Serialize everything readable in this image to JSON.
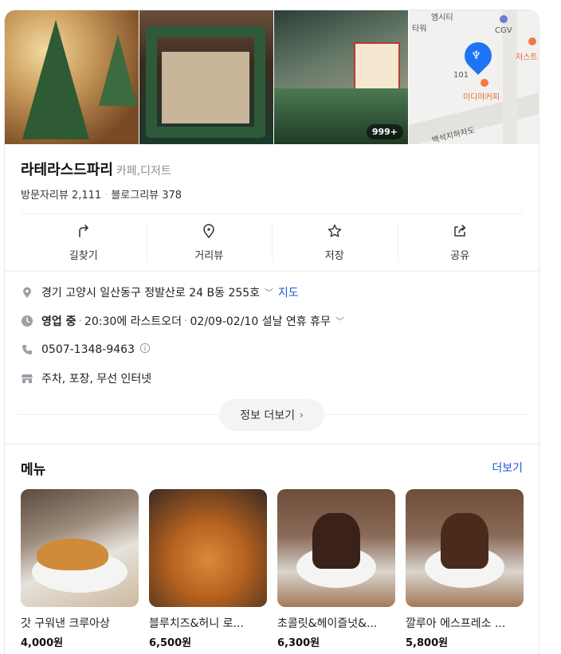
{
  "photos": {
    "more_count": "999+"
  },
  "map": {
    "labels": [
      "엠시티",
      "타워",
      "CGV",
      "저스트",
      "101",
      "이디야커피",
      "백석지하차도"
    ]
  },
  "place": {
    "name": "라테라스드파리",
    "category": "카페,디저트"
  },
  "reviews": {
    "visitor_label": "방문자리뷰",
    "visitor_count": "2,111",
    "blog_label": "블로그리뷰",
    "blog_count": "378"
  },
  "actions": {
    "directions": "길찾기",
    "street_view": "거리뷰",
    "save": "저장",
    "share": "공유"
  },
  "info": {
    "address": "경기 고양시 일산동구 정발산로 24 B동 255호",
    "map_link": "지도",
    "status": "영업 중",
    "last_order": "20:30에 라스트오더",
    "holiday": "02/09-02/10 설날 연휴 휴무",
    "phone": "0507-1348-9463",
    "amenities": "주차, 포장, 무선 인터넷",
    "more_info": "정보 더보기"
  },
  "menu": {
    "title": "메뉴",
    "more": "더보기",
    "items": [
      {
        "name": "갓 구워낸 크루아상",
        "price": "4,000원"
      },
      {
        "name": "블루치즈&허니 로...",
        "price": "6,500원"
      },
      {
        "name": "초콜릿&헤이즐넛&...",
        "price": "6,300원"
      },
      {
        "name": "깔루아 에스프레소 ...",
        "price": "5,800원"
      }
    ]
  },
  "colors": {
    "accent": "#1c5bd4",
    "pin": "#1e74f5"
  }
}
